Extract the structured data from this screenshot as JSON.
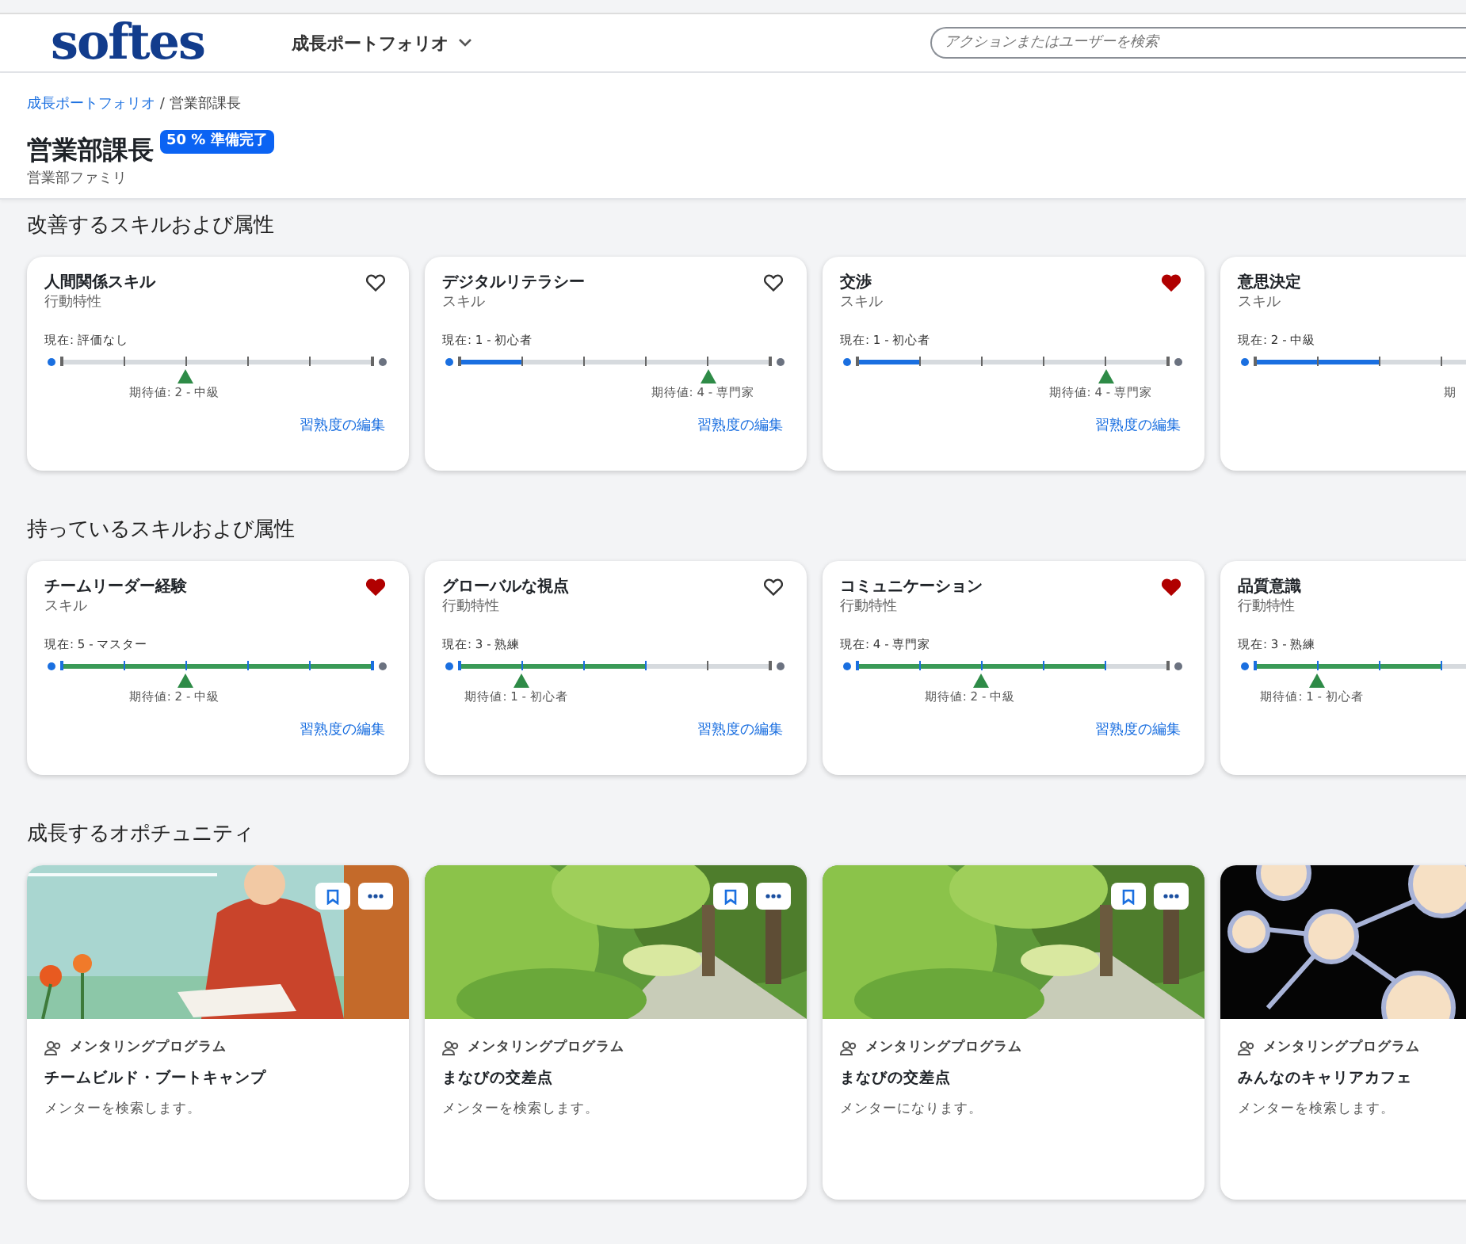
{
  "header": {
    "logo": "softes",
    "nav_menu": "成長ポートフォリオ",
    "search": {
      "placeholder": "アクションまたはユーザーを検索"
    }
  },
  "breadcrumb": [
    {
      "label": "成長ポートフォリオ",
      "kind": "link"
    },
    {
      "label": " / 営業部課長",
      "kind": "current"
    }
  ],
  "page_title": "営業部課長",
  "readiness_badge": "50 % 準備完了",
  "subtitle": "営業部ファミリ",
  "skill_sections": [
    {
      "title": "改善するスキルおよび属性",
      "kind": "improve",
      "cards": [
        {
          "name": "人間関係スキル",
          "type": "行動特性",
          "favorite": false,
          "current": {
            "label": "現在: 評価なし",
            "level": 0
          },
          "expected": {
            "label": "期待値: 2 - 中級",
            "level": 0.4
          },
          "edit_link": "習熟度の編集"
        },
        {
          "name": "デジタルリテラシー",
          "type": "スキル",
          "favorite": false,
          "current": {
            "label": "現在: 1 - 初心者",
            "level": 0.2
          },
          "expected": {
            "label": "期待値: 4 - 専門家",
            "level": 0.8
          },
          "edit_link": "習熟度の編集"
        },
        {
          "name": "交渉",
          "type": "スキル",
          "favorite": true,
          "current": {
            "label": "現在: 1 - 初心者",
            "level": 0.2
          },
          "expected": {
            "label": "期待値: 4 - 専門家",
            "level": 0.8
          },
          "edit_link": "習熟度の編集"
        },
        {
          "name": "意思決定",
          "type": "スキル",
          "current": {
            "label": "現在: 2 - 中級",
            "level": 0.4
          },
          "expected": {
            "label": "期"
          }
        }
      ]
    },
    {
      "title": "持っているスキルおよび属性",
      "kind": "have",
      "cards": [
        {
          "name": "チームリーダー経験",
          "type": "スキル",
          "favorite": true,
          "current": {
            "label": "現在: 5 - マスター",
            "level": 1
          },
          "expected": {
            "label": "期待値: 2 - 中級",
            "level": 0.4
          },
          "edit_link": "習熟度の編集"
        },
        {
          "name": "グローバルな視点",
          "type": "行動特性",
          "favorite": false,
          "current": {
            "label": "現在: 3 - 熟練",
            "level": 0.6
          },
          "expected": {
            "label": "期待値: 1 - 初心者",
            "level": 0.2
          },
          "edit_link": "習熟度の編集"
        },
        {
          "name": "コミュニケーション",
          "type": "行動特性",
          "favorite": true,
          "current": {
            "label": "現在: 4 - 専門家",
            "level": 0.8
          },
          "expected": {
            "label": "期待値: 2 - 中級",
            "level": 0.4
          },
          "edit_link": "習熟度の編集"
        },
        {
          "name": "品質意識",
          "type": "行動特性",
          "current": {
            "label": "現在: 3 - 熟練",
            "level": 0.6
          },
          "expected": {
            "label": "期待値: 1 - 初心者",
            "level": 0.2
          }
        }
      ]
    }
  ],
  "opportunities": {
    "title": "成長するオポチュニティ",
    "cards": [
      {
        "category": "メンタリングプログラム",
        "name": "チームビルド・ブートキャンプ",
        "description": "メンターを検索します。",
        "actions": true
      },
      {
        "category": "メンタリングプログラム",
        "name": "まなびの交差点",
        "description": "メンターを検索します。",
        "actions": true
      },
      {
        "category": "メンタリングプログラム",
        "name": "まなびの交差点",
        "description": "メンターになります。",
        "actions": true
      },
      {
        "category": "メンタリングプログラム",
        "name": "みんなのキャリアカフェ",
        "description": "メンターを検索します。",
        "actions": false
      }
    ]
  }
}
